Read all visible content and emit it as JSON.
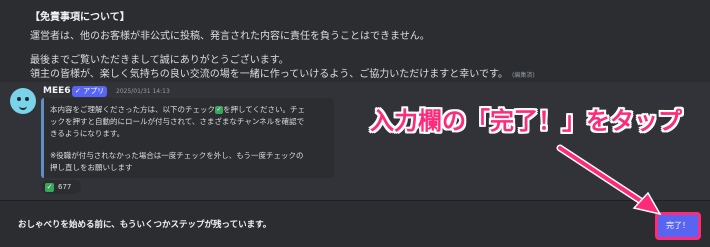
{
  "notice": {
    "heading": "【免責事項について】",
    "line1": "運営者は、他のお客様が非公式に投稿、発言された内容に責任を負うことはできません。",
    "line2": "最後までご覧いただきまして誠にありがとうございます。",
    "line3": "領主の皆様が、楽しく気持ちの良い交流の場を一緒に作っていけるよう、ご協力いただけますと幸いです。",
    "edited": "(編集済)"
  },
  "message": {
    "author": "MEE6",
    "badge": "✓ アプリ",
    "timestamp": "2025/01/31 14:13",
    "embed_line1a": "本内容をご理解くださった方は、以下のチェック",
    "embed_line1b": "を押してください。チェ",
    "embed_line2": "ックを押すと自動的にロールが付与されて、さまざまなチャンネルを確認で",
    "embed_line3": "きるようになります。",
    "embed_line4": "※役職が付与されなかった場合は一度チェックを外し、もう一度チェックの",
    "embed_line5": "押し直しをお願いします",
    "reaction_count": "677"
  },
  "bottom_bar": {
    "text": "おしゃべりを始める前に、もういくつかステップが残っています。",
    "button_label": "完了！"
  },
  "annotation": {
    "text": "入力欄の「完了！」をタップ",
    "color": "#ff2a7a"
  }
}
